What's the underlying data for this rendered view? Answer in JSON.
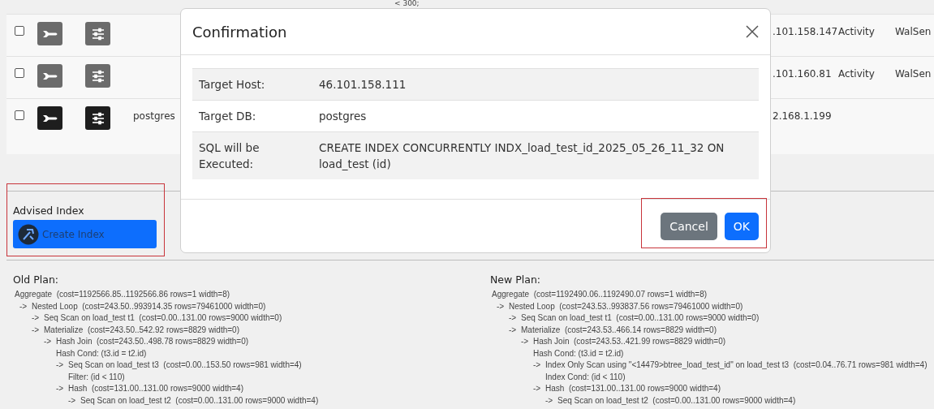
{
  "table": {
    "top_text": "< 300;",
    "rows": [
      {
        "checked": false,
        "active": false,
        "column_5": ".101.158.147",
        "column_6": "Activity",
        "column_7": "WalSen"
      },
      {
        "checked": false,
        "active": false,
        "column_5": ".101.160.81",
        "column_6": "Activity",
        "column_7": "WalSen"
      },
      {
        "checked": false,
        "active": true,
        "column_4": "postgres",
        "column_5": "2.168.1.199"
      }
    ]
  },
  "advised_index": {
    "label": "Advised Index",
    "button": "Create Index"
  },
  "old_plan": {
    "title": "Old Plan:",
    "lines": [
      {
        "text": "Aggregate  (cost=1192566.85..1192566.86 rows=1 width=8)",
        "children": [
          {
            "arrow": "->",
            "text": "Nested Loop  (cost=243.50..993914.35 rows=79461000 width=0)",
            "children": [
              {
                "arrow": "->",
                "text": "Seq Scan on load_test t1  (cost=0.00..131.00 rows=9000 width=0)"
              },
              {
                "arrow": "->",
                "text": "Materialize  (cost=243.50..542.92 rows=8829 width=0)",
                "children": [
                  {
                    "arrow": "->",
                    "text": "Hash Join  (cost=243.50..498.78 rows=8829 width=0)",
                    "children": [
                      {
                        "text": "Hash Cond: (t3.id = t2.id)"
                      },
                      {
                        "arrow": "->",
                        "text": "Seq Scan on load_test t3  (cost=0.00..153.50 rows=981 width=4)",
                        "children": [
                          {
                            "text": "Filter: (id < 110)"
                          }
                        ]
                      },
                      {
                        "arrow": "->",
                        "text": "Hash  (cost=131.00..131.00 rows=9000 width=4)",
                        "children": [
                          {
                            "arrow": "->",
                            "text": "Seq Scan on load_test t2  (cost=0.00..131.00 rows=9000 width=4)"
                          }
                        ]
                      }
                    ]
                  }
                ]
              }
            ]
          }
        ]
      }
    ]
  },
  "new_plan": {
    "title": "New Plan:",
    "lines": [
      {
        "text": "Aggregate  (cost=1192490.06..1192490.07 rows=1 width=8)",
        "children": [
          {
            "arrow": "->",
            "text": "Nested Loop  (cost=243.53..993837.56 rows=79461000 width=0)",
            "children": [
              {
                "arrow": "->",
                "text": "Seq Scan on load_test t1  (cost=0.00..131.00 rows=9000 width=0)"
              },
              {
                "arrow": "->",
                "text": "Materialize  (cost=243.53..466.14 rows=8829 width=0)",
                "children": [
                  {
                    "arrow": "->",
                    "text": "Hash Join  (cost=243.53..421.99 rows=8829 width=0)",
                    "children": [
                      {
                        "text": "Hash Cond: (t3.id = t2.id)"
                      },
                      {
                        "arrow": "->",
                        "text": "Index Only Scan using \"<14479>btree_load_test_id\" on load_test t3  (cost=0.04..76.71 rows=981 width=4)",
                        "children": [
                          {
                            "text": "Index Cond: (id < 110)"
                          }
                        ]
                      },
                      {
                        "arrow": "->",
                        "text": "Hash  (cost=131.00..131.00 rows=9000 width=4)",
                        "children": [
                          {
                            "arrow": "->",
                            "text": "Seq Scan on load_test t2  (cost=0.00..131.00 rows=9000 width=4)"
                          }
                        ]
                      }
                    ]
                  }
                ]
              }
            ]
          }
        ]
      }
    ]
  },
  "dialog": {
    "title": "Confirmation",
    "fields": [
      {
        "label": "Target Host:",
        "value": "46.101.158.111"
      },
      {
        "label": "Target DB:",
        "value": "postgres"
      },
      {
        "label": "SQL will be Executed:",
        "value": "CREATE INDEX CONCURRENTLY INDX_load_test_id_2025_05_26_11_32 ON load_test (id)"
      }
    ],
    "buttons": [
      {
        "label": "Cancel",
        "kind": "secondary"
      },
      {
        "label": "OK",
        "kind": "primary"
      }
    ]
  }
}
